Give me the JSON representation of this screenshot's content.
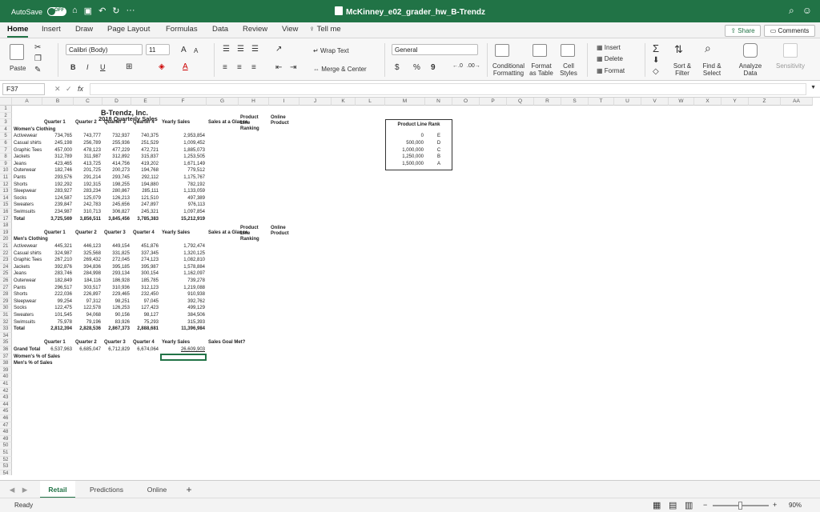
{
  "app": {
    "autosave_label": "AutoSave",
    "autosave_state": "OFF",
    "title": "McKinney_e02_grader_hw_B-Trendz",
    "more": "···"
  },
  "ribbon_tabs": [
    "Home",
    "Insert",
    "Draw",
    "Page Layout",
    "Formulas",
    "Data",
    "Review",
    "View"
  ],
  "tell_me": "Tell me",
  "share": "Share",
  "comments": "Comments",
  "ribbon": {
    "paste": "Paste",
    "font_name": "Calibri (Body)",
    "font_size": "11",
    "bold": "B",
    "italic": "I",
    "underline": "U",
    "grow": "A",
    "shrink": "A",
    "wrap_text": "Wrap Text",
    "merge_center": "Merge & Center",
    "number_format": "General",
    "currency": "$",
    "percent": "%",
    "comma": "9",
    "conditional_formatting": "Conditional Formatting",
    "format_as_table": "Format as Table",
    "cell_styles": "Cell Styles",
    "insert": "Insert",
    "delete": "Delete",
    "format": "Format",
    "sort_filter": "Sort & Filter",
    "find_select": "Find & Select",
    "analyze_data": "Analyze Data",
    "sensitivity": "Sensitivity"
  },
  "formula_bar": {
    "cell_ref": "F37",
    "fx": "fx",
    "value": ""
  },
  "sheet": {
    "columns": [
      "A",
      "B",
      "C",
      "D",
      "E",
      "F",
      "G",
      "H",
      "I",
      "J",
      "K",
      "L",
      "M",
      "N",
      "O",
      "P",
      "Q",
      "R",
      "S",
      "T",
      "U",
      "V",
      "W",
      "X",
      "Y",
      "Z",
      "AA"
    ],
    "title": "B-Trendz, Inc.",
    "subtitle": "2018 Quarterly Sales",
    "headers": [
      "Quarter 1",
      "Quarter 2",
      "Quarter 3",
      "Quarter 4",
      "Yearly Sales",
      "Sales at a Glance",
      "Product Line Ranking",
      "Online Product"
    ],
    "women_label": "Women's Clothing",
    "men_label": "Men's Clothing",
    "women_rows": [
      [
        "Activewear",
        "734,765",
        "743,777",
        "732,937",
        "740,375",
        "2,953,854"
      ],
      [
        "Casual shirts",
        "245,198",
        "256,789",
        "255,936",
        "251,529",
        "1,009,452"
      ],
      [
        "Graphic Tees",
        "457,000",
        "478,123",
        "477,229",
        "472,721",
        "1,885,073"
      ],
      [
        "Jackets",
        "312,789",
        "311,987",
        "312,892",
        "315,837",
        "1,253,505"
      ],
      [
        "Jeans",
        "423,465",
        "413,725",
        "414,756",
        "419,202",
        "1,671,149"
      ],
      [
        "Outerwear",
        "182,746",
        "201,725",
        "200,273",
        "194,768",
        "779,512"
      ],
      [
        "Pants",
        "293,576",
        "291,214",
        "293,745",
        "292,112",
        "1,175,767"
      ],
      [
        "Shorts",
        "192,292",
        "192,315",
        "198,255",
        "194,880",
        "782,192"
      ],
      [
        "Sleepwear",
        "283,927",
        "283,234",
        "280,867",
        "285,111",
        "1,133,059"
      ],
      [
        "Socks",
        "124,587",
        "125,079",
        "126,213",
        "121,510",
        "497,389"
      ],
      [
        "Sweaters",
        "239,847",
        "242,783",
        "245,656",
        "247,897",
        "976,113"
      ],
      [
        "Swimsuits",
        "234,987",
        "310,713",
        "306,827",
        "245,321",
        "1,097,854"
      ],
      [
        "Total",
        "3,725,569",
        "3,856,511",
        "3,845,456",
        "3,785,383",
        "15,212,919"
      ]
    ],
    "men_rows": [
      [
        "Activewear",
        "445,321",
        "446,123",
        "449,154",
        "451,876",
        "1,792,474"
      ],
      [
        "Casual shirts",
        "324,987",
        "325,568",
        "331,825",
        "337,345",
        "1,320,125"
      ],
      [
        "Graphic Tees",
        "267,210",
        "269,432",
        "272,045",
        "274,123",
        "1,082,810"
      ],
      [
        "Jackets",
        "392,876",
        "394,836",
        "395,185",
        "395,987",
        "1,578,884"
      ],
      [
        "Jeans",
        "283,746",
        "284,998",
        "293,134",
        "300,154",
        "1,162,097"
      ],
      [
        "Outerwear",
        "182,849",
        "184,116",
        "186,928",
        "185,785",
        "739,278"
      ],
      [
        "Pants",
        "296,517",
        "303,517",
        "310,936",
        "312,123",
        "1,219,088"
      ],
      [
        "Shorts",
        "222,036",
        "226,897",
        "229,465",
        "232,450",
        "910,938"
      ],
      [
        "Sleepwear",
        "99,254",
        "97,312",
        "98,251",
        "97,045",
        "392,762"
      ],
      [
        "Socks",
        "122,475",
        "122,578",
        "126,253",
        "127,423",
        "499,129"
      ],
      [
        "Sweaters",
        "101,545",
        "94,068",
        "90,156",
        "98,127",
        "384,506"
      ],
      [
        "Swimsuits",
        "75,978",
        "79,196",
        "83,926",
        "75,293",
        "315,393"
      ],
      [
        "Total",
        "2,812,394",
        "2,828,536",
        "2,867,373",
        "2,888,681",
        "11,396,984"
      ]
    ],
    "grand_headers": [
      "Quarter 1",
      "Quarter 2",
      "Quarter 3",
      "Quarter 4",
      "Yearly Sales",
      "Sales Goal Met?"
    ],
    "grand_total_label": "Grand Total",
    "grand_values": [
      "6,537,963",
      "6,685,047",
      "6,712,829",
      "6,674,064",
      "26,609,903"
    ],
    "women_pct_label": "Women's % of Sales",
    "men_pct_label": "Men's % of Sales",
    "rank_title": "Product Line Rank",
    "rank_table": [
      [
        "0",
        "E"
      ],
      [
        "500,000",
        "D"
      ],
      [
        "1,000,000",
        "C"
      ],
      [
        "1,250,000",
        "B"
      ],
      [
        "1,500,000",
        "A"
      ]
    ]
  },
  "sheet_tabs": [
    "Retail",
    "Predictions",
    "Online"
  ],
  "status": {
    "ready": "Ready",
    "zoom": "90%"
  }
}
